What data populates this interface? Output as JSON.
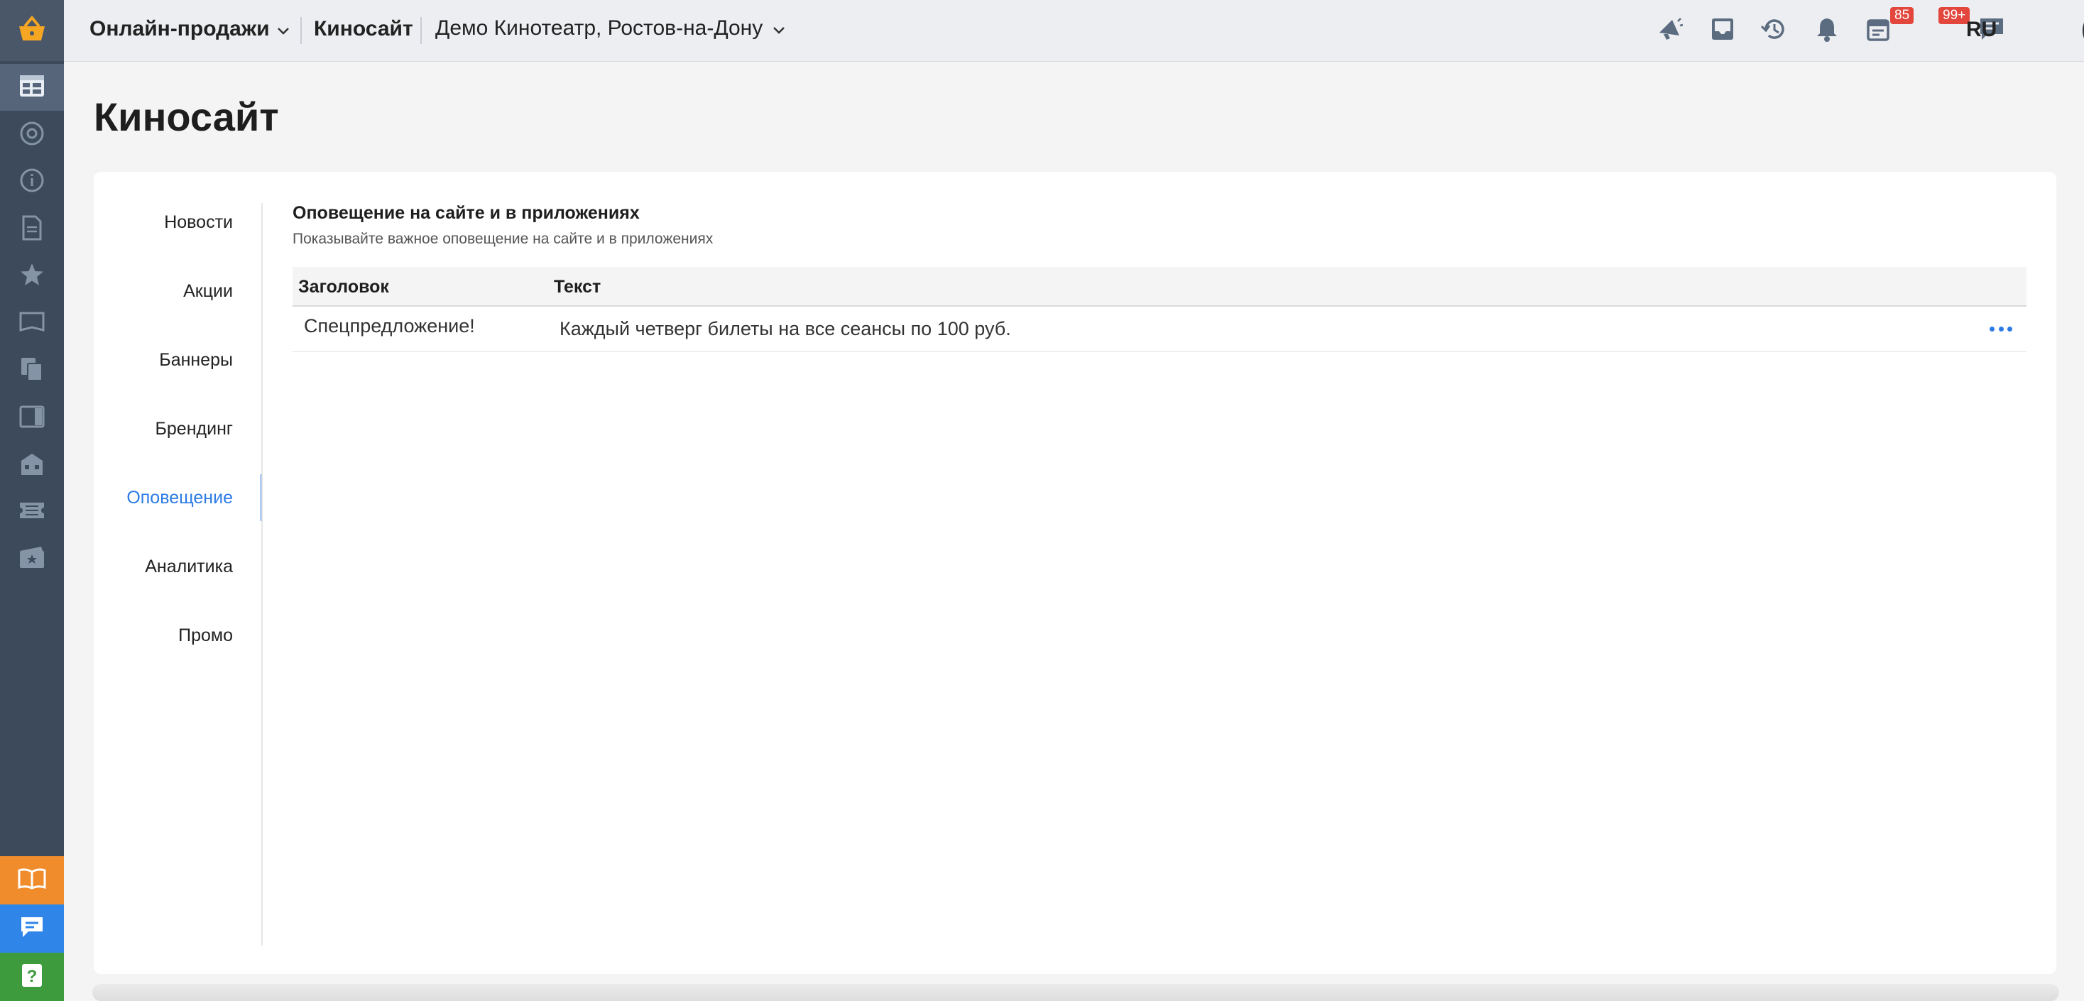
{
  "topbar": {
    "product": "Онлайн-продажи",
    "section": "Киносайт",
    "cinema": "Демо Кинотеатр, Ростов-на-Дону",
    "notifications_badge": "85",
    "tasks_badge": "99+",
    "language": "RU"
  },
  "page": {
    "title": "Киносайт"
  },
  "nav": {
    "items": [
      {
        "label": "Новости"
      },
      {
        "label": "Акции"
      },
      {
        "label": "Баннеры"
      },
      {
        "label": "Брендинг"
      },
      {
        "label": "Оповещение",
        "active": true
      },
      {
        "label": "Аналитика"
      },
      {
        "label": "Промо"
      }
    ]
  },
  "section": {
    "title": "Оповещение на сайте и в приложениях",
    "subtitle": "Показывайте важное оповещение на сайте и в приложениях"
  },
  "table": {
    "columns": [
      "Заголовок",
      "Текст"
    ],
    "rows": [
      {
        "title": "Спецпредложение!",
        "text": "Каждый четверг билеты на все сеансы по 100 руб."
      }
    ]
  },
  "colors": {
    "rail": "#3c4a5b",
    "accent": "#2c7be5",
    "badge": "#e2463c",
    "rail_orange": "#f08c2c",
    "rail_blue": "#2f86e8",
    "rail_green": "#3d9a3d"
  },
  "icons": {
    "rail": [
      "basket-logo-icon",
      "schedule-icon",
      "at-icon",
      "info-icon",
      "document-icon",
      "star-icon",
      "map-icon",
      "copy-icon",
      "panel-icon",
      "building-icon",
      "ticket-icon",
      "film-icon",
      "book-icon",
      "chat-icon",
      "help-icon"
    ],
    "topbar": [
      "megaphone-icon",
      "inbox-icon",
      "history-icon",
      "bell-icon",
      "calendar-icon",
      "message-icon"
    ]
  }
}
